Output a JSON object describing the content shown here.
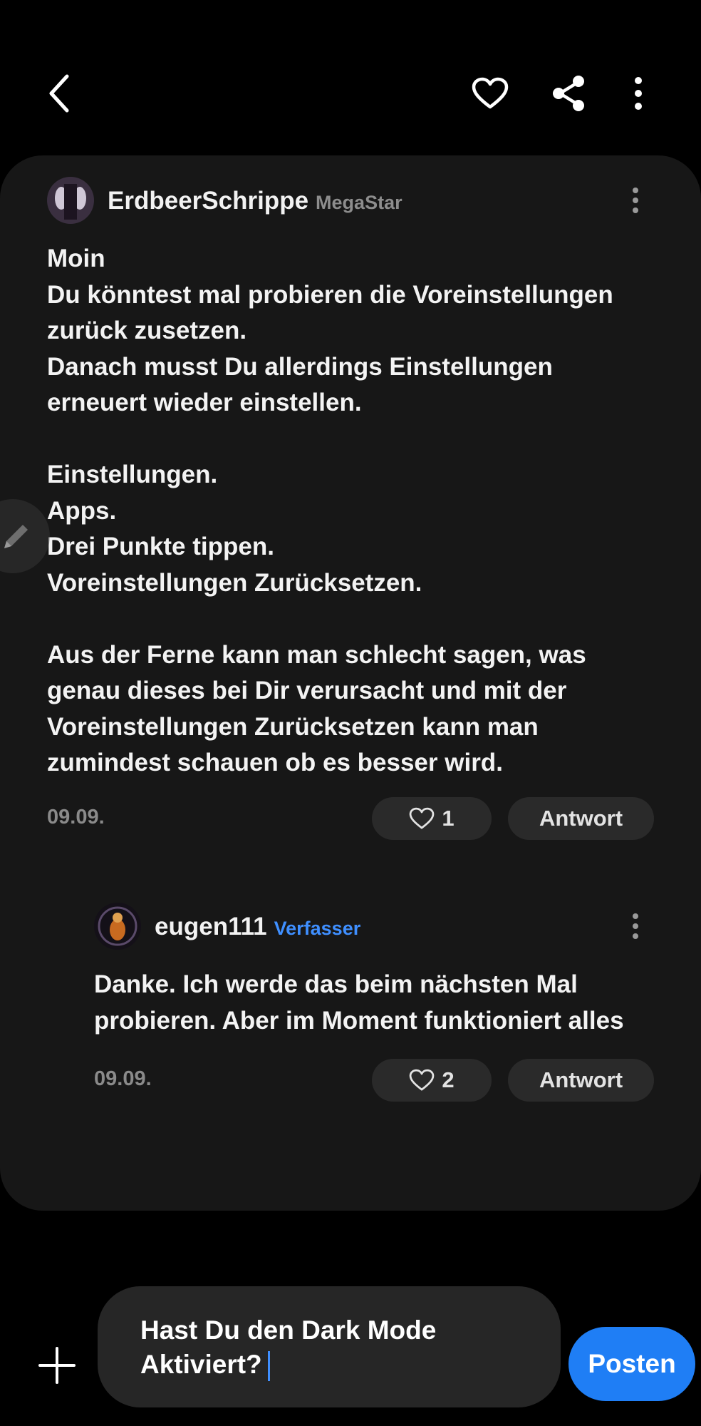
{
  "colors": {
    "background": "#000000",
    "card": "#171717",
    "pill": "#2a2a2a",
    "input": "#262626",
    "accent_blue": "#1f7ef5",
    "author_badge": "#3f8fff",
    "rank_gray": "#8d8d8d"
  },
  "topbar": {
    "icons": [
      "back-arrow-icon",
      "heart-icon",
      "share-icon",
      "more-vertical-icon"
    ]
  },
  "comment": {
    "username": "ErdbeerSchrippe",
    "rank": "MegaStar",
    "lines": [
      "Moin",
      "Du könntest mal probieren die Voreinstellungen",
      "zurück zusetzen.",
      "Danach musst Du allerdings Einstellungen",
      "erneuert wieder einstellen.",
      "",
      "Einstellungen.",
      "Apps.",
      "Drei Punkte tippen.",
      "Voreinstellungen Zurücksetzen.",
      "",
      "Aus der Ferne kann man schlecht sagen, was",
      "genau dieses bei Dir verursacht und mit der",
      "Voreinstellungen Zurücksetzen kann man",
      "zumindest schauen ob es besser wird."
    ],
    "date": "09.09.",
    "likes": "1",
    "reply_label": "Antwort"
  },
  "reply": {
    "username": "eugen111",
    "badge": "Verfasser",
    "lines": [
      "Danke. Ich werde das beim nächsten Mal",
      "probieren. Aber im Moment funktioniert alles"
    ],
    "date": "09.09.",
    "likes": "2",
    "reply_label": "Antwort"
  },
  "composer": {
    "text_line1": "Hast Du den Dark Mode",
    "text_line2": "Aktiviert?",
    "post_label": "Posten"
  }
}
